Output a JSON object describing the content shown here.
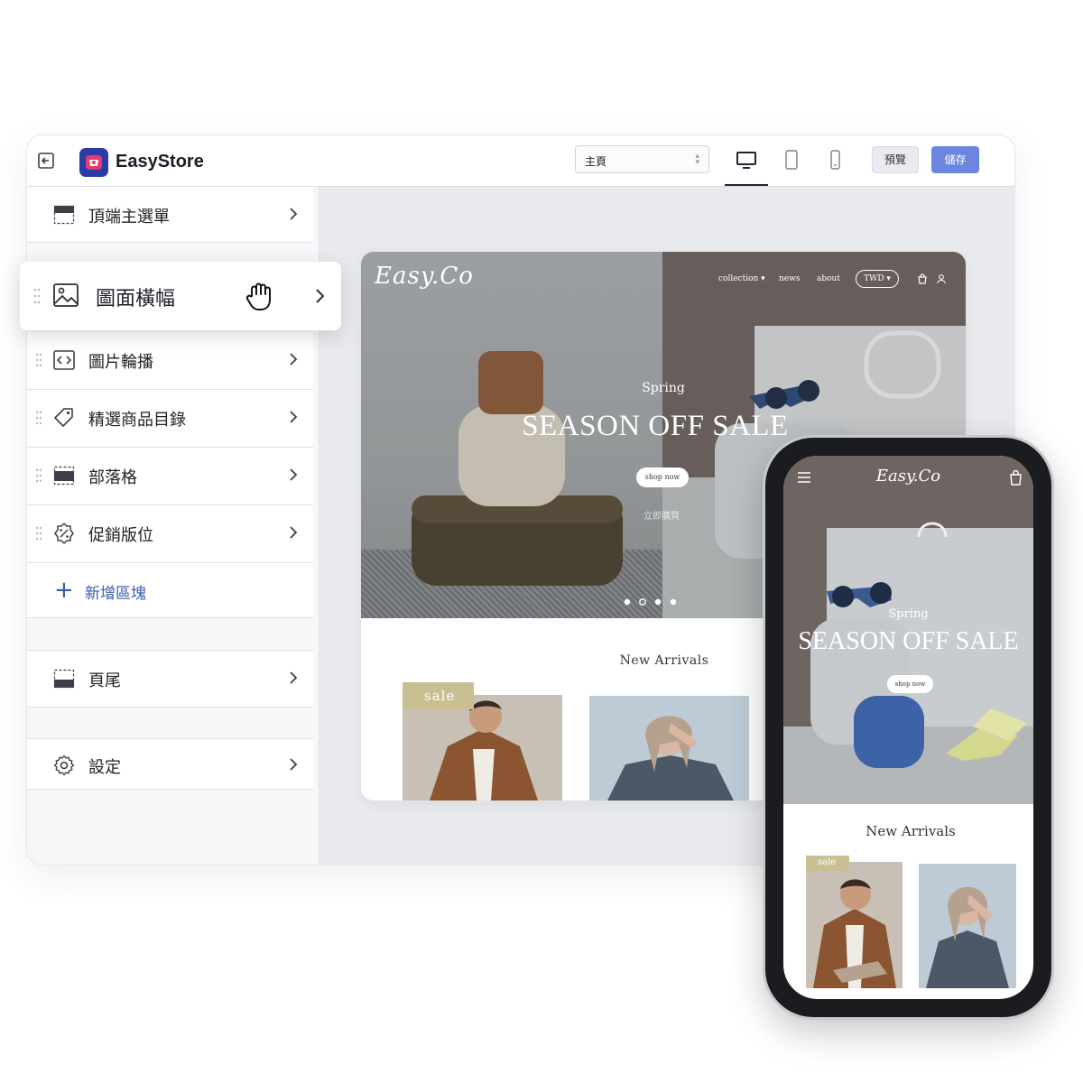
{
  "app": {
    "brand": "EasyStore",
    "page_select": "主頁",
    "preview_label": "預覽",
    "save_label": "儲存"
  },
  "sidebar": {
    "items": [
      {
        "label": "頂端主選單",
        "icon": "header-layout-icon"
      },
      {
        "label": "圖面橫幅",
        "icon": "image-icon"
      },
      {
        "label": "圖片輪播",
        "icon": "slideshow-icon"
      },
      {
        "label": "精選商品目錄",
        "icon": "tag-icon"
      },
      {
        "label": "部落格",
        "icon": "blog-layout-icon"
      },
      {
        "label": "促銷版位",
        "icon": "discount-badge-icon"
      },
      {
        "label": "新增區塊",
        "icon": "plus-icon"
      },
      {
        "label": "頁尾",
        "icon": "footer-layout-icon"
      },
      {
        "label": "設定",
        "icon": "gear-icon"
      }
    ]
  },
  "desktop_preview": {
    "brand": "Easy.Co",
    "nav": [
      "collection ▾",
      "news",
      "about"
    ],
    "currency": "TWD ▾",
    "hero_kicker": "Spring",
    "hero_title": "SEASON OFF SALE",
    "hero_button": "shop now",
    "hero_sub": "立即購買",
    "section_title": "New Arrivals",
    "sale_tag": "sale"
  },
  "mobile_preview": {
    "brand": "Easy.Co",
    "hero_kicker": "Spring",
    "hero_title": "SEASON OFF SALE",
    "hero_button": "shop now",
    "section_title": "New Arrivals",
    "sale_tag": "sale"
  },
  "colors": {
    "brand_blue": "#2a3da6",
    "save_button": "#6b86df",
    "add_section_link": "#3559b0",
    "sale_tag": "#c8bf92"
  }
}
